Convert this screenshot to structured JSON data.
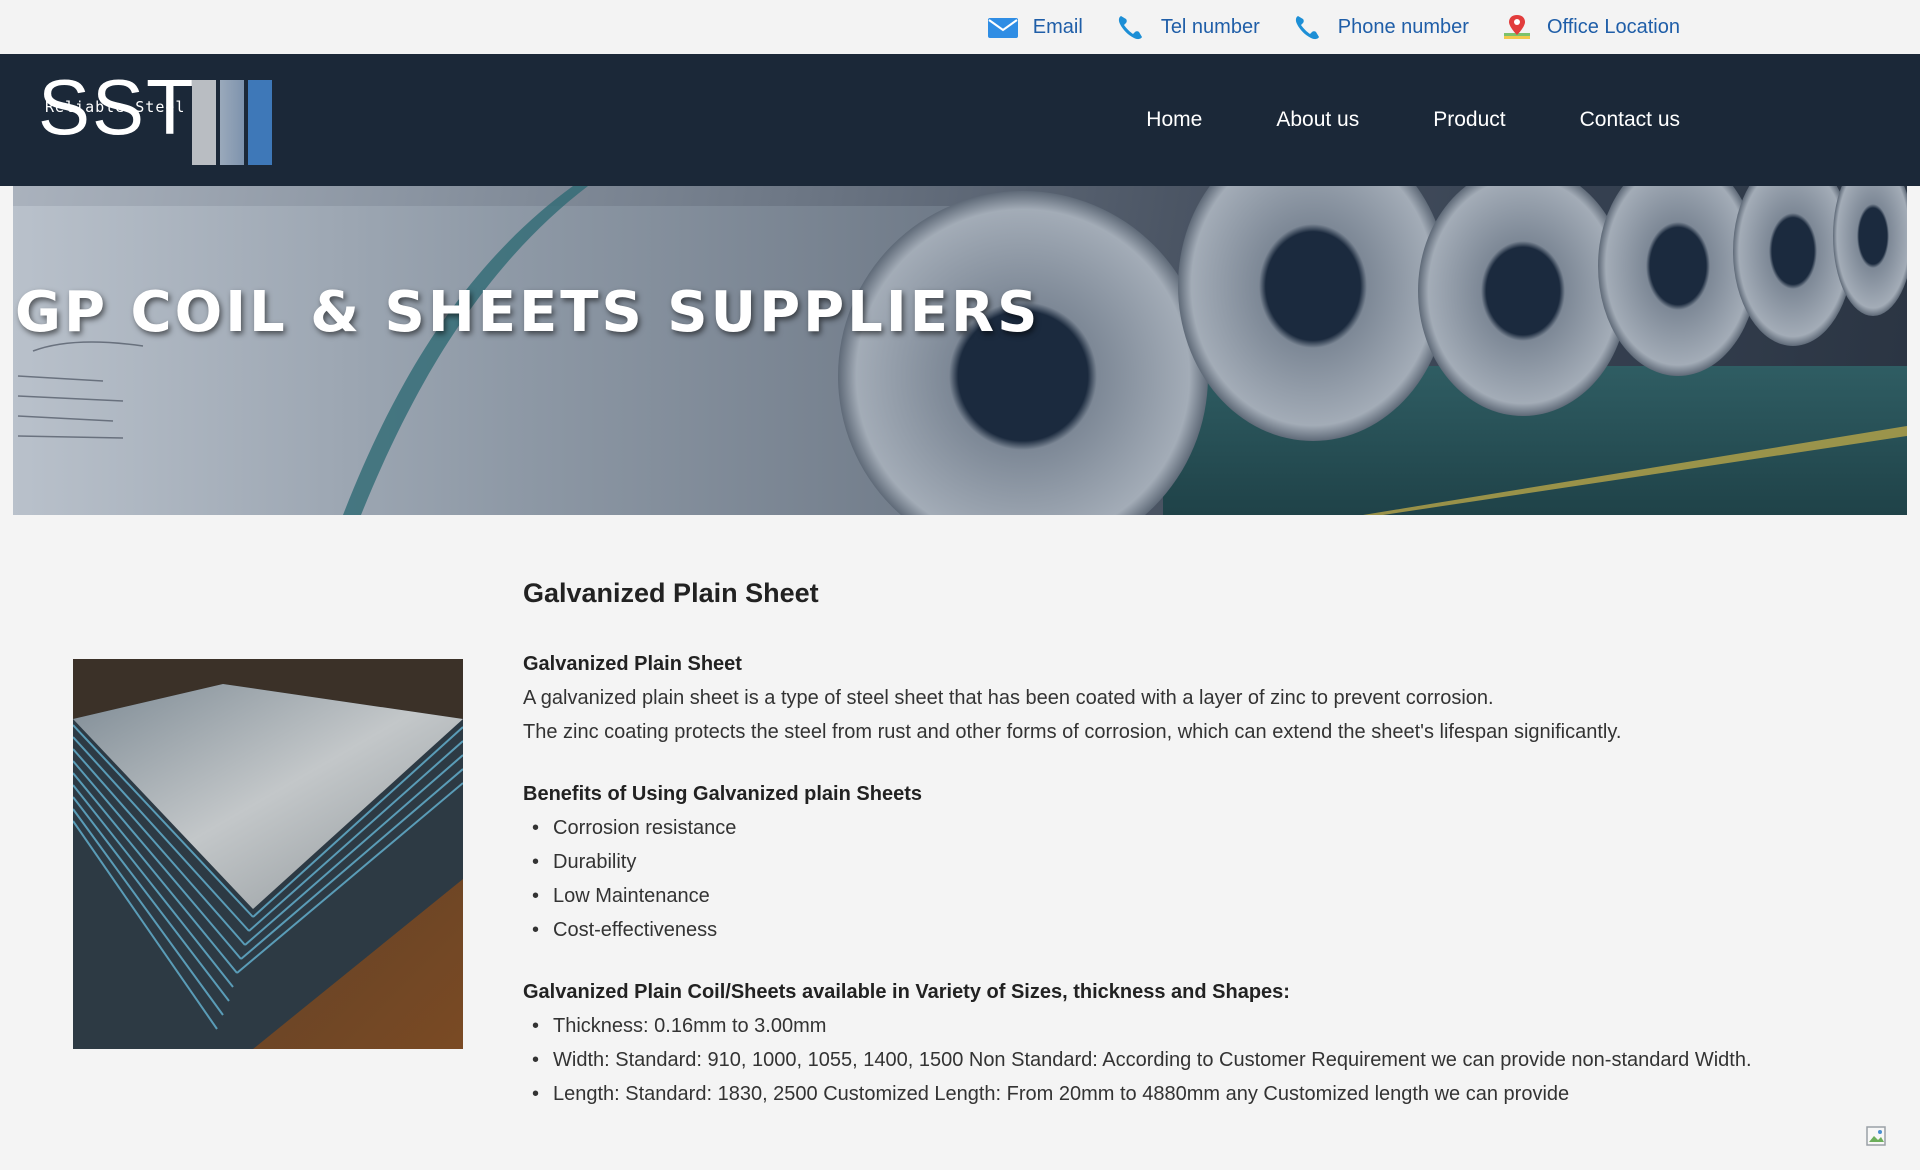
{
  "topbar": {
    "contacts": [
      {
        "icon": "envelope-icon",
        "label": "Email"
      },
      {
        "icon": "phone-icon",
        "label": "Tel number"
      },
      {
        "icon": "phone-icon",
        "label": "Phone number"
      },
      {
        "icon": "map-pin-icon",
        "label": "Office Location"
      }
    ]
  },
  "logo": {
    "wordmark": "SST",
    "tagline": "Reliable Steel"
  },
  "nav": {
    "items": [
      "Home",
      "About us",
      "Product",
      "Contact us"
    ]
  },
  "hero": {
    "title": "GP COIL & SHEETS SUPPLIERS"
  },
  "main": {
    "heading": "Galvanized Plain Sheet",
    "intro": {
      "title": "Galvanized Plain Sheet",
      "lines": [
        "A galvanized plain sheet is a type of steel sheet that has been coated with a layer of zinc to prevent corrosion.",
        "The zinc coating protects the steel from rust and other forms of corrosion, which can extend the sheet's lifespan significantly."
      ]
    },
    "benefits": {
      "title": "Benefits of Using Galvanized plain Sheets",
      "items": [
        "Corrosion resistance",
        "Durability",
        "Low Maintenance",
        "Cost-effectiveness"
      ]
    },
    "sizes": {
      "title": "Galvanized Plain Coil/Sheets available in Variety of Sizes, thickness and Shapes:",
      "items": [
        "Thickness: 0.16mm to 3.00mm",
        "Width: Standard: 910, 1000, 1055, 1400, 1500 Non Standard: According to Customer Requirement we can provide non-standard Width.",
        "Length: Standard: 1830, 2500 Customized Length: From 20mm to 4880mm any Customized length we can provide"
      ]
    }
  },
  "colors": {
    "header_bg": "#1b2838",
    "link_blue": "#1f5ea8",
    "logo_bar_1": "#b9bdc2",
    "logo_bar_2": "#7e93ad",
    "logo_bar_3": "#3e78b8"
  }
}
